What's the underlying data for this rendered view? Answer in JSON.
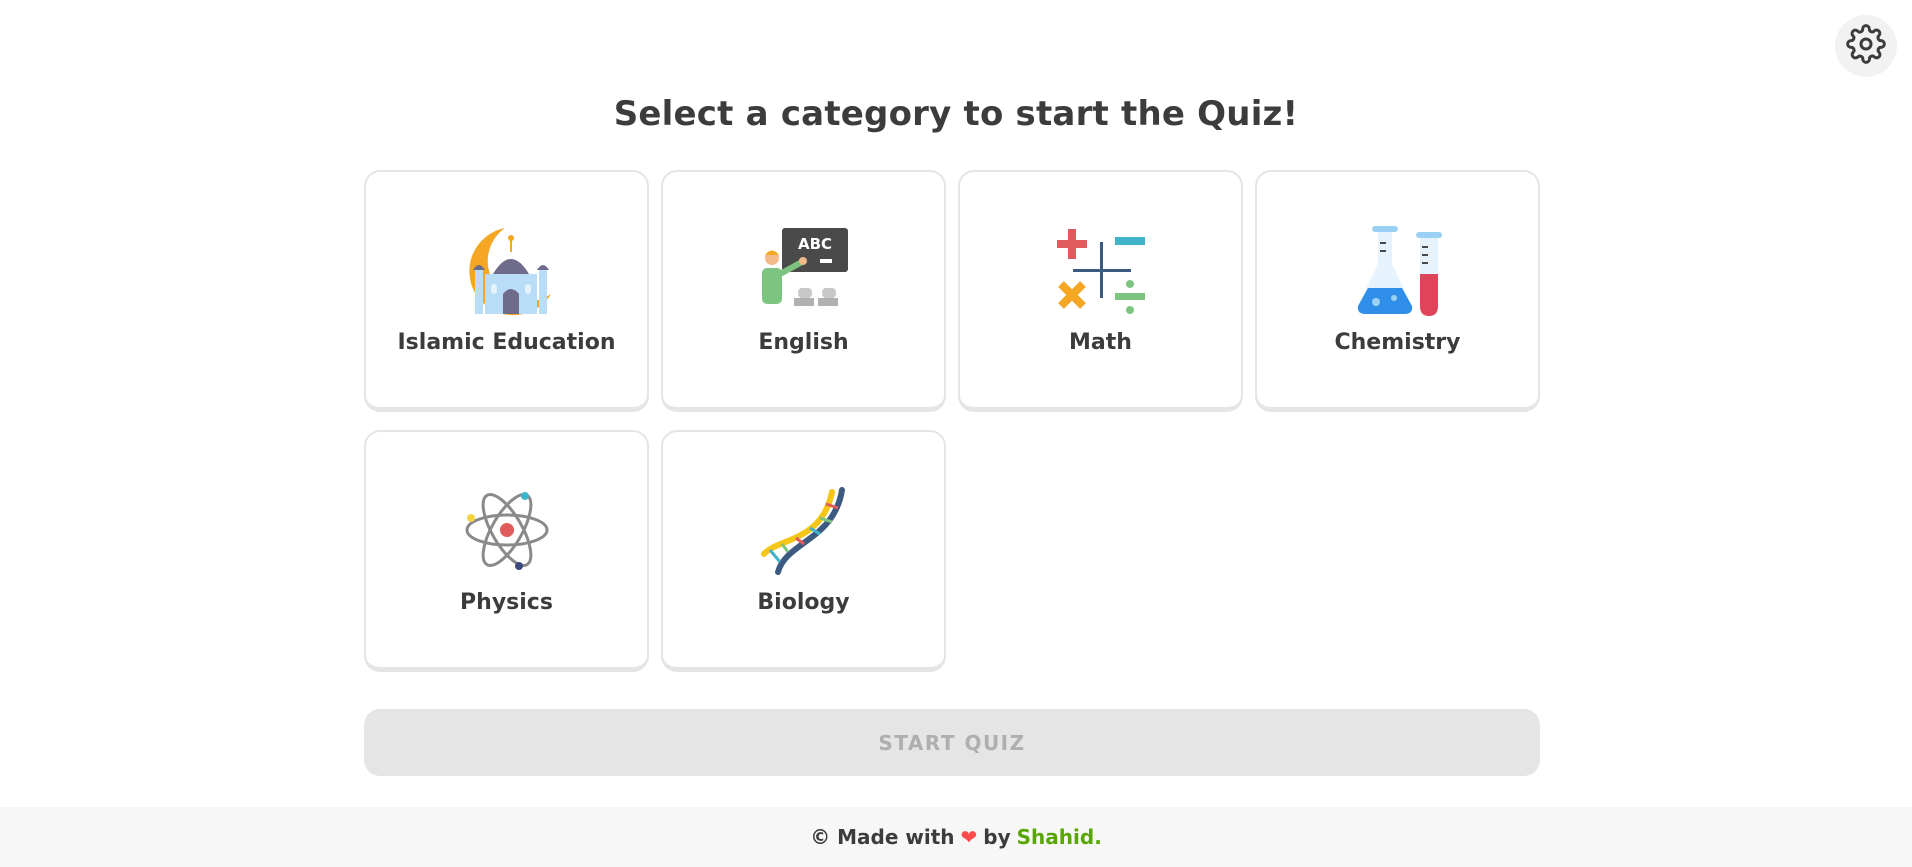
{
  "header": {
    "title": "Select a category to start the Quiz!",
    "settings_icon": "gear-icon"
  },
  "categories": [
    {
      "label": "Islamic Education",
      "icon": "mosque-icon"
    },
    {
      "label": "English",
      "icon": "teacher-blackboard-icon"
    },
    {
      "label": "Math",
      "icon": "math-operators-icon"
    },
    {
      "label": "Chemistry",
      "icon": "flask-test-tube-icon"
    },
    {
      "label": "Physics",
      "icon": "atom-icon"
    },
    {
      "label": "Biology",
      "icon": "dna-icon"
    }
  ],
  "start_button": {
    "label": "START QUIZ"
  },
  "footer": {
    "copyright": "© Made with",
    "heart_icon": "heart-icon",
    "by": "by",
    "author": "Shahid."
  },
  "colors": {
    "accent_green": "#58a700",
    "heart_red": "#ff4b4b",
    "disabled_bg": "#e5e5e5",
    "disabled_text": "#afafaf"
  }
}
